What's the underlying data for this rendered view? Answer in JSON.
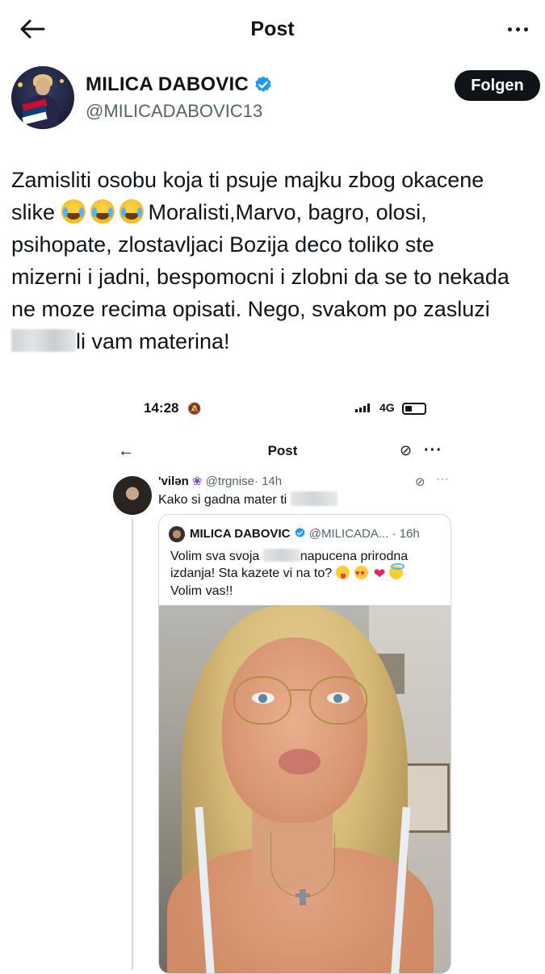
{
  "header": {
    "title": "Post"
  },
  "author": {
    "name": "MILICA DABOVIC",
    "handle": "@MILICADABOVIC13",
    "verified": true,
    "follow_label": "Folgen"
  },
  "tweet": {
    "line1": "Zamisliti osobu koja ti psuje majku zbog okacene",
    "line2_start": "slike ",
    "line2_end": "Moralisti,Marvo, bagro, olosi,",
    "line3": "psihopate, zlostavljaci Bozija deco toliko ste",
    "line4": "mizerni i jadni, bespomocni i zlobni da se to nekada",
    "line5": "ne moze recima opisati. Nego, svakom po zasluzi",
    "line6_end": "li vam materina!",
    "emoji": [
      "face-with-tears-of-joy",
      "face-with-tears-of-joy",
      "face-with-tears-of-joy"
    ]
  },
  "embedded_screenshot": {
    "status_time": "14:28",
    "network": "4G",
    "nav_title": "Post",
    "reply": {
      "name": "'vilən",
      "handle": "@trgnise",
      "time": "· 14h",
      "text": "Kako si gadna mater ti"
    },
    "quote": {
      "name": "MILICA DABOVIC",
      "handle": "@MILICADA...",
      "time": "· 16h",
      "text_a": "Volim sva svoja",
      "text_b": "napucena prirodna",
      "text_c": "izdanja! Sta kazete vi na to?",
      "text_d": "Volim vas!!"
    }
  },
  "colors": {
    "text": "#0f1419",
    "secondary": "#536471",
    "verified": "#1d9bf0",
    "border": "#cfd9de"
  }
}
